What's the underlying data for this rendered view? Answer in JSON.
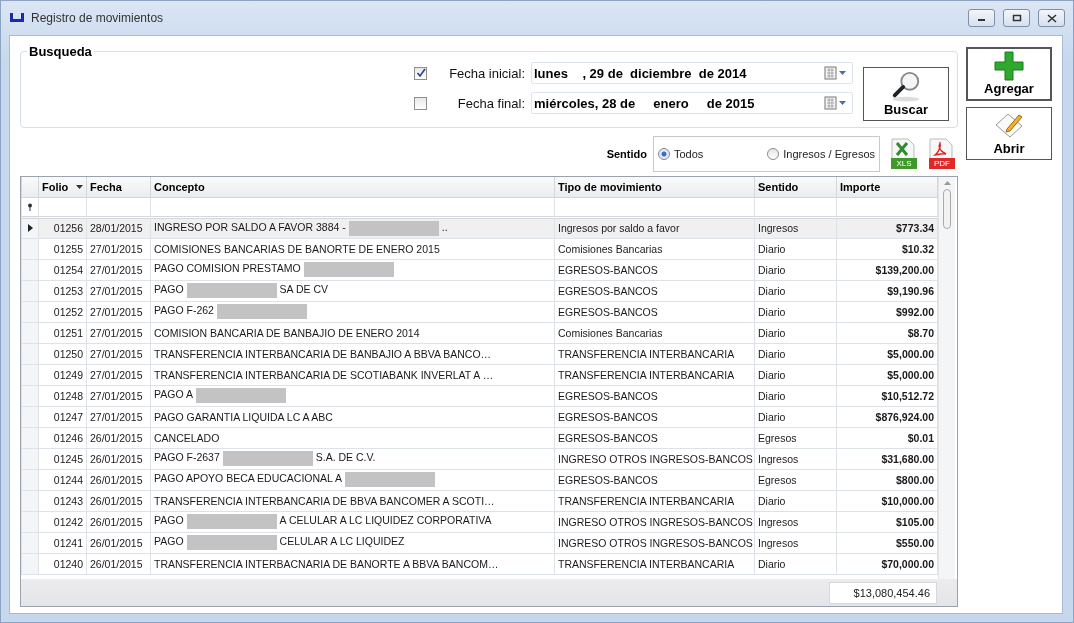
{
  "window": {
    "title": "Registro de movimientos"
  },
  "search": {
    "title": "Busqueda",
    "date_filters": [
      {
        "label": "Fecha inicial:",
        "checked": true,
        "value": "lunes    , 29 de  diciembre  de 2014"
      },
      {
        "label": "Fecha final:",
        "checked": false,
        "value": "miércoles, 28 de     enero     de 2015"
      }
    ],
    "button": "Buscar"
  },
  "actions": [
    {
      "kind": "add",
      "label": "Agregar"
    },
    {
      "kind": "open",
      "label": "Abrir"
    }
  ],
  "direction": {
    "label": "Sentido",
    "options": [
      {
        "label": "Todos",
        "selected": true
      },
      {
        "label": "Ingresos / Egresos",
        "selected": false
      }
    ]
  },
  "exports": [
    {
      "kind": "xls",
      "label": "XLS"
    },
    {
      "kind": "pdf",
      "label": "PDF"
    }
  ],
  "table": {
    "columns": [
      {
        "label": "Folio",
        "sorted": true
      },
      {
        "label": "Fecha",
        "sorted": false
      },
      {
        "label": "Concepto",
        "sorted": false
      },
      {
        "label": "Tipo de movimiento",
        "sorted": false
      },
      {
        "label": "Sentido",
        "sorted": false
      },
      {
        "label": "Importe",
        "sorted": false
      }
    ],
    "rows": [
      {
        "folio": "01256",
        "fecha": "28/01/2015",
        "concepto": [
          {
            "kind": "text",
            "text": "INGRESO POR SALDO A FAVOR 3884 -"
          },
          {
            "kind": "redacted"
          },
          {
            "kind": "text",
            "text": ".."
          }
        ],
        "tipo": "Ingresos por saldo a favor",
        "sentido": "Ingresos",
        "importe": "$773.34",
        "selected": true
      },
      {
        "folio": "01255",
        "fecha": "27/01/2015",
        "concepto": [
          {
            "kind": "text",
            "text": "COMISIONES BANCARIAS DE BANORTE DE ENERO 2015"
          }
        ],
        "tipo": "Comisiones Bancarias",
        "sentido": "Diario",
        "importe": "$10.32",
        "selected": false
      },
      {
        "folio": "01254",
        "fecha": "27/01/2015",
        "concepto": [
          {
            "kind": "text",
            "text": "PAGO COMISION PRESTAMO"
          },
          {
            "kind": "redacted"
          }
        ],
        "tipo": "EGRESOS-BANCOS",
        "sentido": "Diario",
        "importe": "$139,200.00",
        "selected": false
      },
      {
        "folio": "01253",
        "fecha": "27/01/2015",
        "concepto": [
          {
            "kind": "text",
            "text": "PAGO"
          },
          {
            "kind": "redacted"
          },
          {
            "kind": "text",
            "text": "SA DE CV"
          }
        ],
        "tipo": "EGRESOS-BANCOS",
        "sentido": "Diario",
        "importe": "$9,190.96",
        "selected": false
      },
      {
        "folio": "01252",
        "fecha": "27/01/2015",
        "concepto": [
          {
            "kind": "text",
            "text": "PAGO F-262"
          },
          {
            "kind": "redacted"
          }
        ],
        "tipo": "EGRESOS-BANCOS",
        "sentido": "Diario",
        "importe": "$992.00",
        "selected": false
      },
      {
        "folio": "01251",
        "fecha": "27/01/2015",
        "concepto": [
          {
            "kind": "text",
            "text": "COMISION BANCARIA DE BANBAJIO DE ENERO 2014"
          }
        ],
        "tipo": "Comisiones Bancarias",
        "sentido": "Diario",
        "importe": "$8.70",
        "selected": false
      },
      {
        "folio": "01250",
        "fecha": "27/01/2015",
        "concepto": [
          {
            "kind": "text",
            "text": "TRANSFERENCIA INTERBANCARIA DE BANBAJIO A BBVA BANCO…"
          }
        ],
        "tipo": "TRANSFERENCIA INTERBANCARIA",
        "sentido": "Diario",
        "importe": "$5,000.00",
        "selected": false
      },
      {
        "folio": "01249",
        "fecha": "27/01/2015",
        "concepto": [
          {
            "kind": "text",
            "text": "TRANSFERENCIA INTERBANCARIA DE SCOTIABANK INVERLAT A …"
          }
        ],
        "tipo": "TRANSFERENCIA INTERBANCARIA",
        "sentido": "Diario",
        "importe": "$5,000.00",
        "selected": false
      },
      {
        "folio": "01248",
        "fecha": "27/01/2015",
        "concepto": [
          {
            "kind": "text",
            "text": "PAGO A"
          },
          {
            "kind": "redacted"
          }
        ],
        "tipo": "EGRESOS-BANCOS",
        "sentido": "Diario",
        "importe": "$10,512.72",
        "selected": false
      },
      {
        "folio": "01247",
        "fecha": "27/01/2015",
        "concepto": [
          {
            "kind": "text",
            "text": "PAGO GARANTIA LIQUIDA LC A ABC"
          }
        ],
        "tipo": "EGRESOS-BANCOS",
        "sentido": "Diario",
        "importe": "$876,924.00",
        "selected": false
      },
      {
        "folio": "01246",
        "fecha": "26/01/2015",
        "concepto": [
          {
            "kind": "text",
            "text": "CANCELADO"
          }
        ],
        "tipo": "EGRESOS-BANCOS",
        "sentido": "Egresos",
        "importe": "$0.01",
        "selected": false
      },
      {
        "folio": "01245",
        "fecha": "26/01/2015",
        "concepto": [
          {
            "kind": "text",
            "text": "PAGO F-2637"
          },
          {
            "kind": "redacted"
          },
          {
            "kind": "text",
            "text": "S.A. DE C.V."
          }
        ],
        "tipo": "INGRESO OTROS INGRESOS-BANCOS",
        "sentido": "Ingresos",
        "importe": "$31,680.00",
        "selected": false
      },
      {
        "folio": "01244",
        "fecha": "26/01/2015",
        "concepto": [
          {
            "kind": "text",
            "text": "PAGO APOYO BECA EDUCACIONAL A"
          },
          {
            "kind": "redacted"
          }
        ],
        "tipo": "EGRESOS-BANCOS",
        "sentido": "Egresos",
        "importe": "$800.00",
        "selected": false
      },
      {
        "folio": "01243",
        "fecha": "26/01/2015",
        "concepto": [
          {
            "kind": "text",
            "text": "TRANSFERENCIA INTERBANCARIA DE BBVA BANCOMER A SCOTI…"
          }
        ],
        "tipo": "TRANSFERENCIA INTERBANCARIA",
        "sentido": "Diario",
        "importe": "$10,000.00",
        "selected": false
      },
      {
        "folio": "01242",
        "fecha": "26/01/2015",
        "concepto": [
          {
            "kind": "text",
            "text": "PAGO"
          },
          {
            "kind": "redacted"
          },
          {
            "kind": "text",
            "text": "A CELULAR A LC LIQUIDEZ CORPORATIVA"
          }
        ],
        "tipo": "INGRESO OTROS INGRESOS-BANCOS",
        "sentido": "Ingresos",
        "importe": "$105.00",
        "selected": false
      },
      {
        "folio": "01241",
        "fecha": "26/01/2015",
        "concepto": [
          {
            "kind": "text",
            "text": "PAGO"
          },
          {
            "kind": "redacted"
          },
          {
            "kind": "text",
            "text": "CELULAR A LC LIQUIDEZ"
          }
        ],
        "tipo": "INGRESO OTROS INGRESOS-BANCOS",
        "sentido": "Ingresos",
        "importe": "$550.00",
        "selected": false
      },
      {
        "folio": "01240",
        "fecha": "26/01/2015",
        "concepto": [
          {
            "kind": "text",
            "text": "TRANSFERENCIA INTERBACNARIA DE BANORTE A BBVA BANCOM…"
          }
        ],
        "tipo": "TRANSFERENCIA INTERBANCARIA",
        "sentido": "Diario",
        "importe": "$70,000.00",
        "selected": false
      }
    ],
    "total": "$13,080,454.46"
  }
}
